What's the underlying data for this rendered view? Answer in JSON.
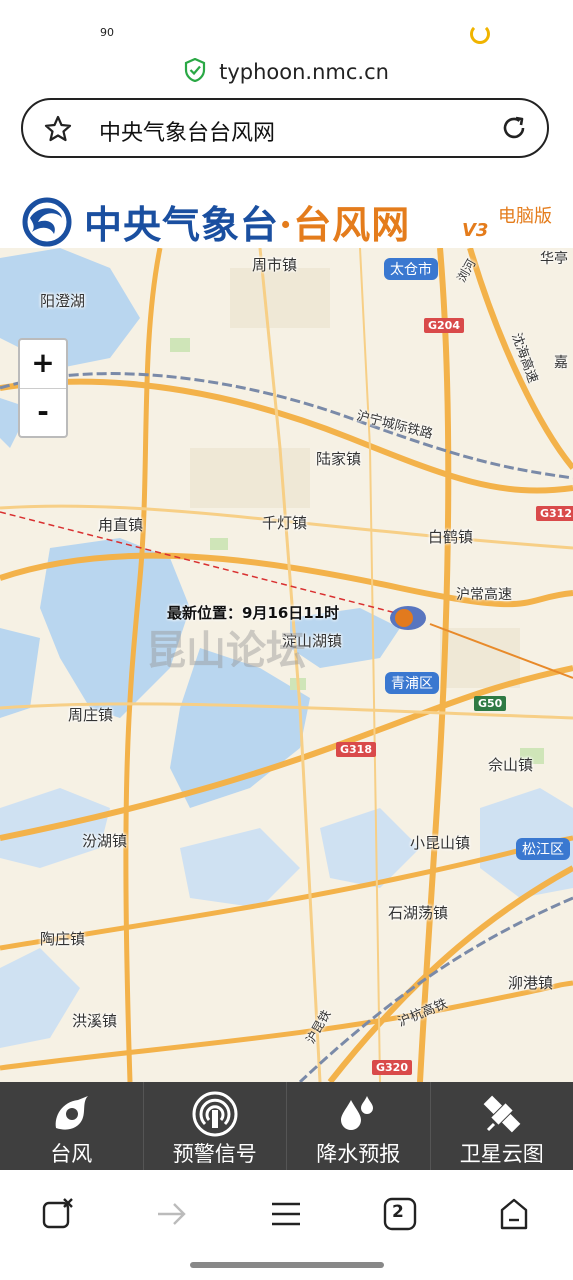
{
  "status_bar": {
    "number": "90"
  },
  "browser": {
    "domain": "typhoon.nmc.cn",
    "page_title": "中央气象台台风网",
    "tab_count": "2"
  },
  "site_header": {
    "brand_part1": "中央气象台",
    "brand_dot": "·",
    "brand_part2": "台风网",
    "version": "V3",
    "pc_version_link": "电脑版"
  },
  "map": {
    "zoom_in": "+",
    "zoom_out": "-",
    "latest_position": "最新位置：9月16日11时",
    "watermark": "昆山论坛",
    "places": {
      "zhoushi": "周市镇",
      "yangchenghu": "阳澄湖",
      "lujia": "陆家镇",
      "luzhi": "甪直镇",
      "qiandeng": "千灯镇",
      "baihe": "白鹤镇",
      "dianshanhu": "淀山湖镇",
      "zhouzhuang": "周庄镇",
      "yushan": "佘山镇",
      "fenhu": "汾湖镇",
      "xiaokunshan": "小昆山镇",
      "shihudang": "石湖荡镇",
      "taozhuang": "陶庄镇",
      "maogang": "泖港镇",
      "hongxi": "洪溪镇",
      "rail_husu": "沪宁城际铁路",
      "hi_huchang": "沪常高速",
      "rail_hukun": "沪昆铁",
      "rail_huhang": "沪杭高铁",
      "hi_yanjiang": "沈海高速",
      "liuhe": "浏河",
      "jia": "嘉",
      "hua": "华亭"
    },
    "district_tags": {
      "taicang": "太仓市",
      "qingpu": "青浦区",
      "songjiang": "松江区"
    },
    "road_shields": {
      "g204": "G204",
      "g312": "G312",
      "g50": "G50",
      "g318": "G318",
      "g320": "G320"
    }
  },
  "bottom_tabs": [
    {
      "label": "台风",
      "icon": "typhoon-icon"
    },
    {
      "label": "预警信号",
      "icon": "warning-signal-icon"
    },
    {
      "label": "降水预报",
      "icon": "rain-drop-icon"
    },
    {
      "label": "卫星云图",
      "icon": "satellite-icon"
    }
  ]
}
